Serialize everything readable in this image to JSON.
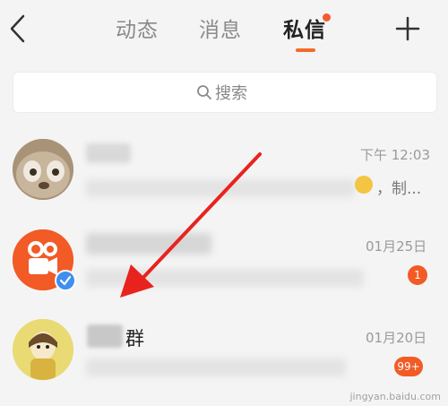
{
  "header": {
    "tabs": [
      {
        "label": "动态"
      },
      {
        "label": "消息"
      },
      {
        "label": "私信"
      }
    ]
  },
  "search": {
    "placeholder": "搜索"
  },
  "conversations": [
    {
      "time": "下午 12:03",
      "preview_tail": "，制..."
    },
    {
      "time": "01月25日",
      "badge": "1"
    },
    {
      "name_suffix": "群",
      "time": "01月20日",
      "badge": "99+"
    }
  ],
  "watermark": "jingyan.baidu.com",
  "colors": {
    "accent": "#f26b2a",
    "badge": "#f25b26",
    "arrow": "#e8231e"
  }
}
